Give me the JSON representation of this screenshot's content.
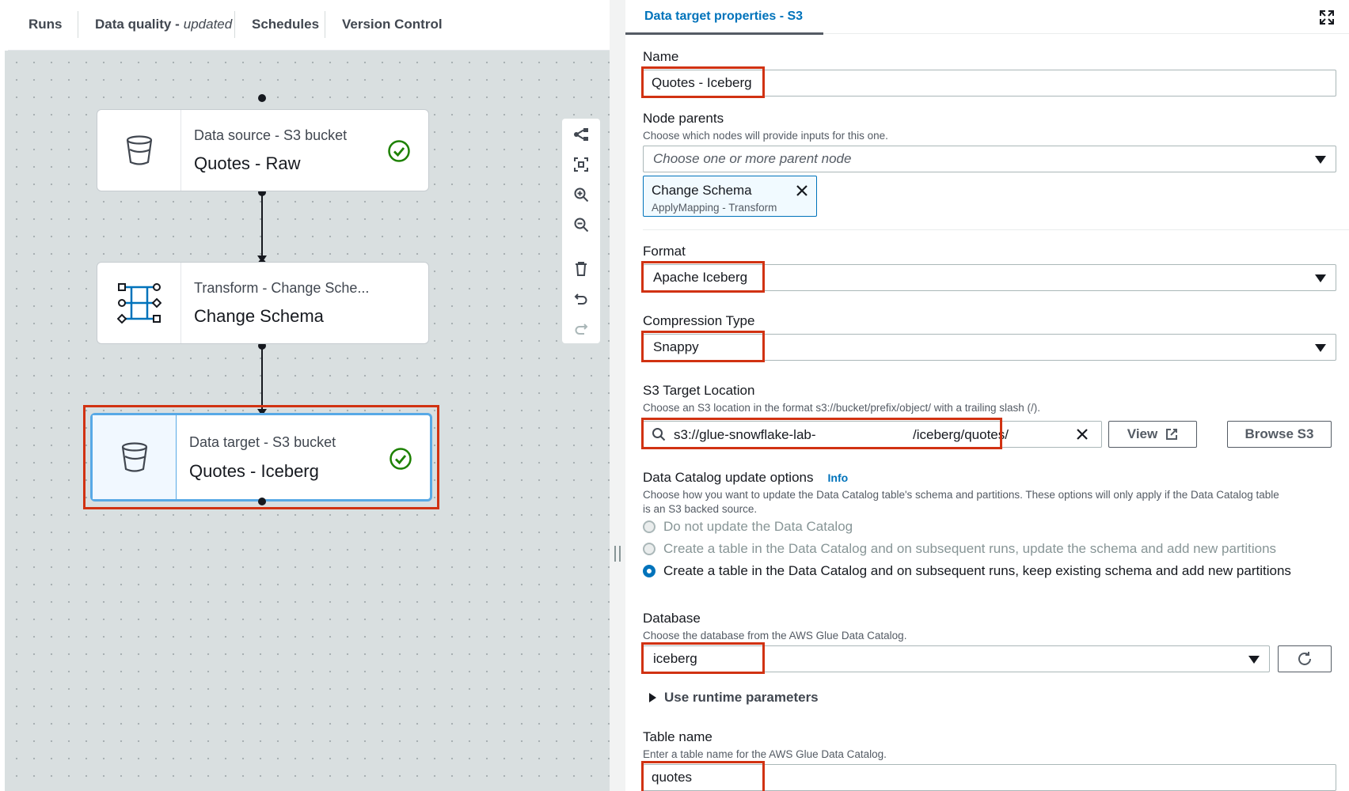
{
  "tabs": {
    "runs": "Runs",
    "data_quality": "Data quality -",
    "data_quality_status": "updated",
    "schedules": "Schedules",
    "version_control": "Version Control"
  },
  "nodes": [
    {
      "kind": "Data source - S3 bucket",
      "title": "Quotes - Raw",
      "icon": "bucket-icon",
      "status": "success"
    },
    {
      "kind": "Transform - Change Sche...",
      "title": "Change Schema",
      "icon": "transform-icon",
      "status": ""
    },
    {
      "kind": "Data target - S3 bucket",
      "title": "Quotes - Iceberg",
      "icon": "bucket-icon",
      "status": "success",
      "selected": true
    }
  ],
  "toolbar_icons": [
    "layout-icon",
    "fit-view-icon",
    "zoom-in-icon",
    "zoom-out-icon",
    "delete-icon",
    "undo-icon",
    "redo-icon"
  ],
  "panel": {
    "tab_title": "Data target properties - S3",
    "name": {
      "label": "Name",
      "value": "Quotes - Iceberg"
    },
    "node_parents": {
      "label": "Node parents",
      "description": "Choose which nodes will provide inputs for this one.",
      "placeholder": "Choose one or more parent node",
      "token_title": "Change Schema",
      "token_subtitle": "ApplyMapping - Transform"
    },
    "format": {
      "label": "Format",
      "value": "Apache Iceberg"
    },
    "compression": {
      "label": "Compression Type",
      "value": "Snappy"
    },
    "s3_location": {
      "label": "S3 Target Location",
      "description": "Choose an S3 location in the format s3://bucket/prefix/object/ with a trailing slash (/).",
      "value_prefix": "s3://glue-snowflake-lab-",
      "value_suffix": "/iceberg/quotes/",
      "view_label": "View",
      "browse_label": "Browse S3"
    },
    "catalog": {
      "label": "Data Catalog update options",
      "info": "Info",
      "description_line1": "Choose how you want to update the Data Catalog table's schema and partitions. These options will only apply if the Data Catalog table",
      "description_line2": "is an S3 backed source.",
      "options": [
        "Do not update the Data Catalog",
        "Create a table in the Data Catalog and on subsequent runs, update the schema and add new partitions",
        "Create a table in the Data Catalog and on subsequent runs, keep existing schema and add new partitions"
      ],
      "selected_index": 2
    },
    "database": {
      "label": "Database",
      "description": "Choose the database from the AWS Glue Data Catalog.",
      "value": "iceberg"
    },
    "runtime_params": "Use runtime parameters",
    "table_name": {
      "label": "Table name",
      "description": "Enter a table name for the AWS Glue Data Catalog.",
      "value": "quotes"
    }
  },
  "colors": {
    "accent": "#0073bb",
    "highlight": "#d13212",
    "success": "#1d8102",
    "selected_border": "#58a9e6"
  }
}
